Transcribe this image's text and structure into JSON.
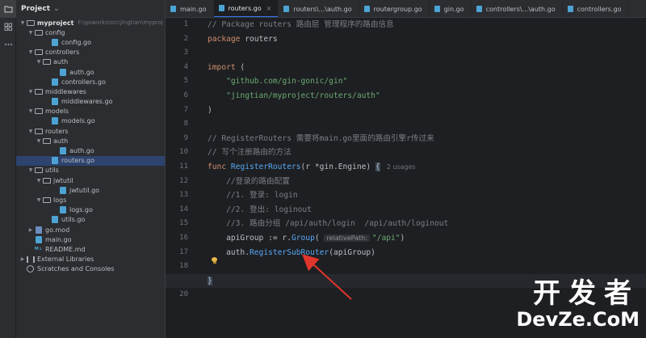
{
  "project": {
    "title": "Project",
    "root_name": "myproject",
    "root_path": "F:\\goworks\\src\\jingtian\\myproj",
    "tree": [
      {
        "label": "config",
        "type": "folder",
        "depth": 1,
        "open": true
      },
      {
        "label": "config.go",
        "type": "go",
        "depth": 3
      },
      {
        "label": "controllers",
        "type": "folder",
        "depth": 1,
        "open": true
      },
      {
        "label": "auth",
        "type": "folder",
        "depth": 2,
        "open": true
      },
      {
        "label": "auth.go",
        "type": "go",
        "depth": 4
      },
      {
        "label": "controllers.go",
        "type": "go",
        "depth": 3
      },
      {
        "label": "middlewares",
        "type": "folder",
        "depth": 1,
        "open": true
      },
      {
        "label": "middlewares.go",
        "type": "go",
        "depth": 3
      },
      {
        "label": "models",
        "type": "folder",
        "depth": 1,
        "open": true
      },
      {
        "label": "models.go",
        "type": "go",
        "depth": 3
      },
      {
        "label": "routers",
        "type": "folder",
        "depth": 1,
        "open": true
      },
      {
        "label": "auth",
        "type": "folder",
        "depth": 2,
        "open": true
      },
      {
        "label": "auth.go",
        "type": "go",
        "depth": 4
      },
      {
        "label": "routers.go",
        "type": "go",
        "depth": 3,
        "selected": true
      },
      {
        "label": "utils",
        "type": "folder",
        "depth": 1,
        "open": true
      },
      {
        "label": "jwtutil",
        "type": "folder",
        "depth": 2,
        "open": true
      },
      {
        "label": "jwtutil.go",
        "type": "go",
        "depth": 4
      },
      {
        "label": "logs",
        "type": "folder",
        "depth": 2,
        "open": true
      },
      {
        "label": "logs.go",
        "type": "go",
        "depth": 4
      },
      {
        "label": "utils.go",
        "type": "go",
        "depth": 3
      },
      {
        "label": "go.mod",
        "type": "mod",
        "depth": 1,
        "collapsed": true
      },
      {
        "label": "main.go",
        "type": "go",
        "depth": 1
      },
      {
        "label": "README.md",
        "type": "md",
        "depth": 1
      }
    ],
    "external_libraries": "External Libraries",
    "scratches": "Scratches and Consoles"
  },
  "tabs": [
    {
      "label": "main.go",
      "active": false,
      "closable": false
    },
    {
      "label": "routers.go",
      "active": true,
      "closable": true
    },
    {
      "label": "routers\\...\\auth.go",
      "active": false,
      "closable": false
    },
    {
      "label": "routergroup.go",
      "active": false,
      "closable": false
    },
    {
      "label": "gin.go",
      "active": false,
      "closable": false
    },
    {
      "label": "controllers\\...\\auth.go",
      "active": false,
      "closable": false
    },
    {
      "label": "controllers.go",
      "active": false,
      "closable": false
    }
  ],
  "editor": {
    "current_line": 19,
    "line_numbers": [
      "1",
      "2",
      "3",
      "4",
      "5",
      "6",
      "7",
      "8",
      "9",
      "10",
      "11",
      "12",
      "13",
      "14",
      "15",
      "16",
      "17",
      "18",
      "19",
      "20"
    ],
    "line1_comment": "// Package routers 路由层 管理程序的路由信息",
    "line2_kw": "package",
    "line2_name": " routers",
    "line4_kw": "import",
    "line4_paren": " (",
    "line5_str": "\"github.com/gin-gonic/gin\"",
    "line6_str": "\"jingtian/myproject/routers/auth\"",
    "line7_paren": ")",
    "line9_comment": "// RegisterRouters 需要将main.go里面的路由引擎r传过来",
    "line10_comment": "// 写个注册路由的方法",
    "line11_kw": "func",
    "line11_fn": " RegisterRouters",
    "line11_params": "(r *gin.Engine)",
    "line11_brace": "{",
    "line11_usages": "2 usages",
    "line12_comment": "//登录的路由配置",
    "line13_comment": "//1. 登录: login",
    "line14_comment": "//2. 登出: loginout",
    "line15_comment": "//3. 路由分组 /api/auth/login  /api/auth/loginout",
    "line16_pre": "apiGroup := r.",
    "line16_fn": "Group",
    "line16_open": "(",
    "line16_hint": "relativePath:",
    "line16_str": "\"/api\"",
    "line16_close": ")",
    "line17_pkg": "auth.",
    "line17_fn": "RegisterSubRouter",
    "line17_args": "(apiGroup)",
    "line19_brace": "}"
  },
  "watermark": {
    "cn": "开发者",
    "en": "DevZe.CoM"
  },
  "colors": {
    "keyword": "#cf8e6d",
    "string": "#6aab73",
    "comment": "#7a7e85",
    "function": "#56a8f5",
    "arrow": "#e0352b",
    "selection": "#2e436e",
    "accent": "#3574f0"
  }
}
